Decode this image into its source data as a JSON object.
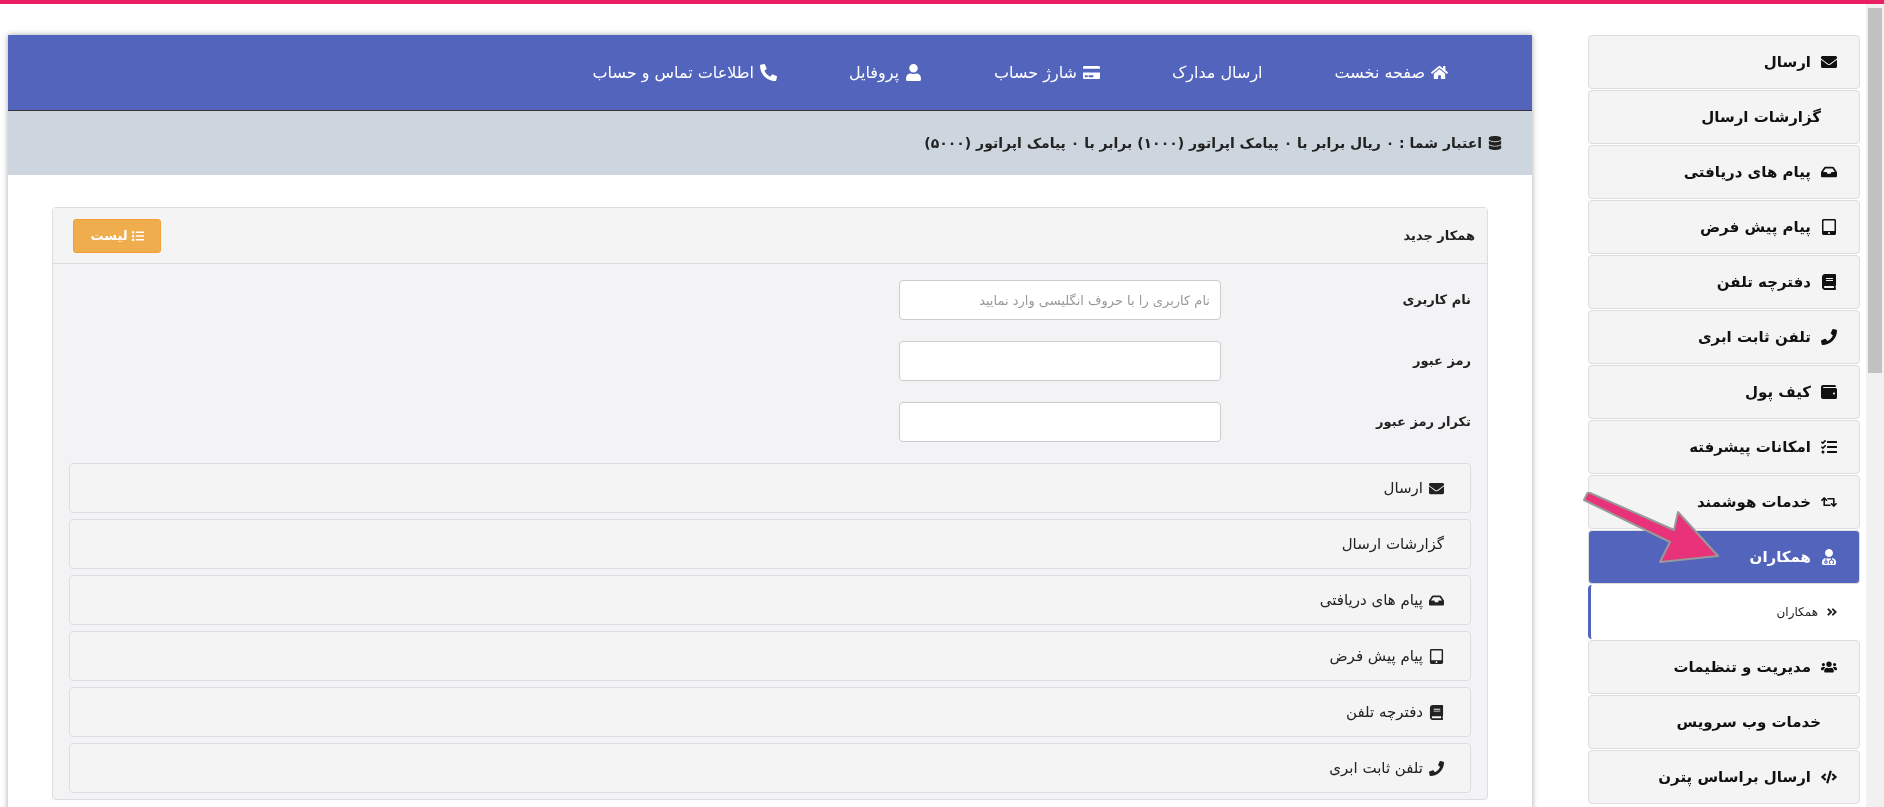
{
  "top_nav": {
    "items": [
      {
        "label": "صفحه نخست"
      },
      {
        "label": "ارسال مدارک"
      },
      {
        "label": "شارژ حساب"
      },
      {
        "label": "پروفایل"
      },
      {
        "label": "اطلاعات تماس و حساب"
      }
    ]
  },
  "credit_bar": {
    "text": "اعتبار شما : ۰ ریال برابر با ۰ پیامک اپراتور (۱۰۰۰) برابر با ۰ پیامک اپراتور (۵۰۰۰)"
  },
  "card": {
    "title": "همکار جدید",
    "list_button": "لیست",
    "fields": [
      {
        "label": "نام کاربری",
        "placeholder": "نام کاربری را با حروف انگلیسی وارد نمایید"
      },
      {
        "label": "رمز عبور"
      },
      {
        "label": "تکرار رمز عبور"
      }
    ],
    "accordion": [
      {
        "label": "ارسال"
      },
      {
        "label": "گزارشات ارسال"
      },
      {
        "label": "پیام های دریافتی"
      },
      {
        "label": "پیام پیش فرض"
      },
      {
        "label": "دفترچه تلفن"
      },
      {
        "label": "تلفن ثابت ابری"
      }
    ]
  },
  "sidebar": {
    "items": [
      {
        "label": "ارسال",
        "selected": false
      },
      {
        "label": "گزارشات ارسال",
        "selected": false
      },
      {
        "label": "پیام های دریافتی",
        "selected": false
      },
      {
        "label": "پیام پیش فرض",
        "selected": false
      },
      {
        "label": "دفترچه تلفن",
        "selected": false
      },
      {
        "label": "تلفن ثابت ابری",
        "selected": false
      },
      {
        "label": "کیف پول",
        "selected": false
      },
      {
        "label": "امکانات پیشرفته",
        "selected": false
      },
      {
        "label": "خدمات هوشمند",
        "selected": false
      },
      {
        "label": "همکاران",
        "selected": true,
        "children": [
          {
            "label": "همکاران"
          }
        ]
      },
      {
        "label": "مدیریت و تنظیمات",
        "selected": false
      },
      {
        "label": "خدمات وب سرویس",
        "selected": false
      },
      {
        "label": "ارسال براساس پترن",
        "selected": false
      }
    ]
  }
}
